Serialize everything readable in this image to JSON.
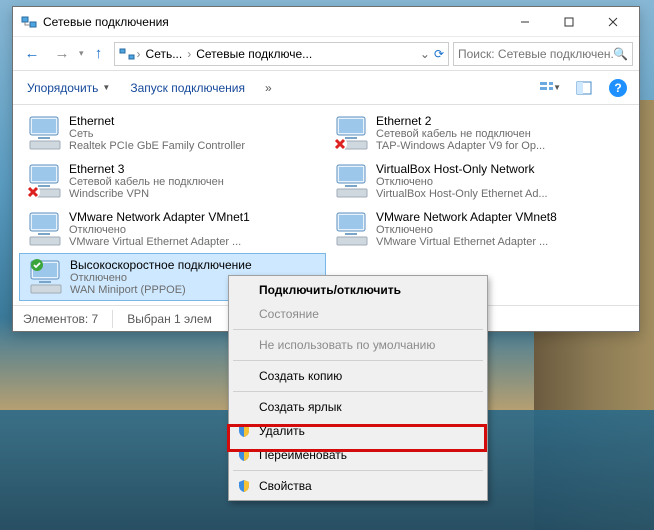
{
  "window": {
    "title": "Сетевые подключения"
  },
  "nav": {
    "breadcrumb": {
      "seg1": "Сеть...",
      "seg2": "Сетевые подключе..."
    },
    "search_placeholder": "Поиск: Сетевые подключен..."
  },
  "toolbar": {
    "organize": "Упорядочить",
    "start_conn": "Запуск подключения"
  },
  "connections": [
    {
      "name": "Ethernet",
      "line2": "Сеть",
      "line3": "Realtek PCIe GbE Family Controller",
      "state": "ok"
    },
    {
      "name": "Ethernet 2",
      "line2": "Сетевой кабель не подключен",
      "line3": "TAP-Windows Adapter V9 for Op...",
      "state": "x"
    },
    {
      "name": "Ethernet 3",
      "line2": "Сетевой кабель не подключен",
      "line3": "Windscribe VPN",
      "state": "x"
    },
    {
      "name": "VirtualBox Host-Only Network",
      "line2": "Отключено",
      "line3": "VirtualBox Host-Only Ethernet Ad...",
      "state": "warn"
    },
    {
      "name": "VMware Network Adapter VMnet1",
      "line2": "Отключено",
      "line3": "VMware Virtual Ethernet Adapter ...",
      "state": "warn"
    },
    {
      "name": "VMware Network Adapter VMnet8",
      "line2": "Отключено",
      "line3": "VMware Virtual Ethernet Adapter ...",
      "state": "warn"
    },
    {
      "name": "Высокоскоростное подключение",
      "line2": "Отключено",
      "line3": "WAN Miniport (PPPOE)",
      "state": "selcheck"
    }
  ],
  "statusbar": {
    "count_label": "Элементов: 7",
    "selected_label": "Выбран 1 элем"
  },
  "context": {
    "connect": "Подключить/отключить",
    "status": "Состояние",
    "nodefault": "Не использовать по умолчанию",
    "copy": "Создать копию",
    "shortcut": "Создать ярлык",
    "delete": "Удалить",
    "rename": "Переименовать",
    "properties": "Свойства"
  }
}
